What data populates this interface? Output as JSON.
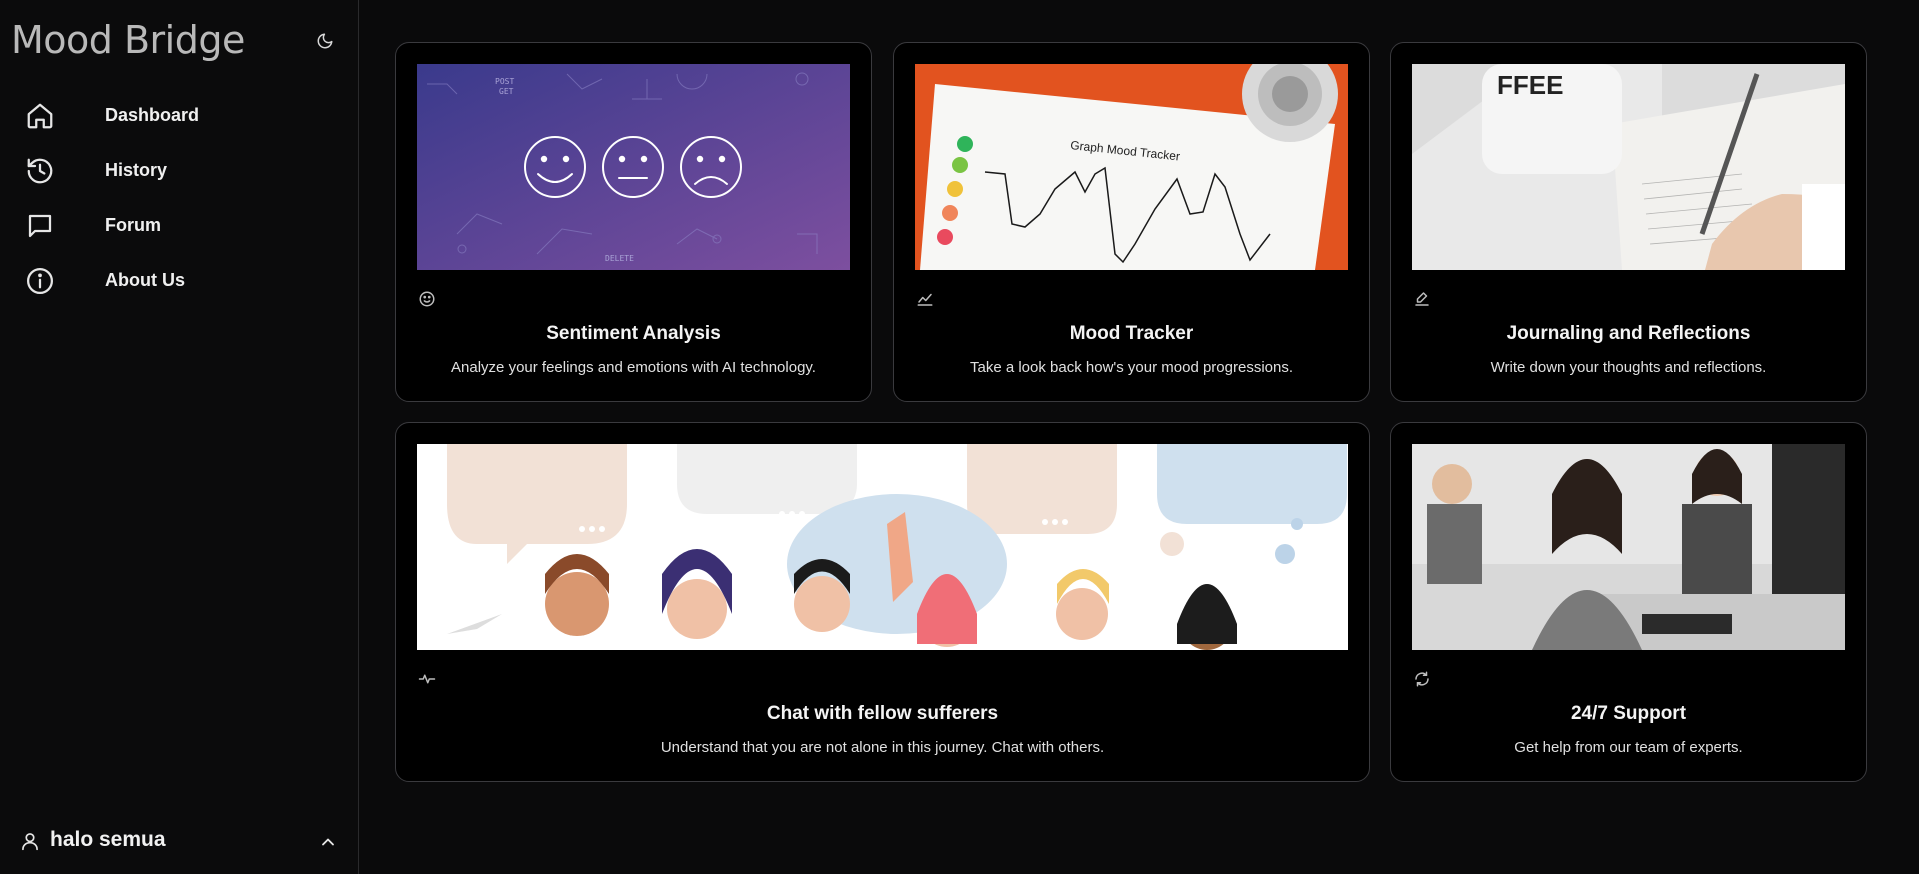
{
  "app": {
    "title": "Mood Bridge"
  },
  "sidebar": {
    "items": [
      {
        "label": "Dashboard",
        "icon": "home-icon"
      },
      {
        "label": "History",
        "icon": "history-icon"
      },
      {
        "label": "Forum",
        "icon": "chat-bubble-icon"
      },
      {
        "label": "About Us",
        "icon": "info-icon"
      }
    ]
  },
  "user": {
    "name": "halo semua"
  },
  "cards": [
    {
      "title": "Sentiment Analysis",
      "description": "Analyze your feelings and emotions with AI technology.",
      "icon": "face-smile-icon"
    },
    {
      "title": "Mood Tracker",
      "description": "Take a look back how's your mood progressions.",
      "icon": "line-chart-icon",
      "image_text": "Graph Mood Tracker"
    },
    {
      "title": "Journaling and Reflections",
      "description": "Write down your thoughts and reflections.",
      "icon": "pen-icon",
      "image_text": "FFEE"
    },
    {
      "title": "Chat with fellow sufferers",
      "description": "Understand that you are not alone in this journey. Chat with others.",
      "icon": "pulse-icon"
    },
    {
      "title": "24/7 Support",
      "description": "Get help from our team of experts.",
      "icon": "refresh-icon"
    }
  ],
  "colors": {
    "background": "#0a0a0b",
    "card_background": "#000000",
    "card_border": "#3a3a3e",
    "sentiment_gradient_start": "#3d3a8e",
    "sentiment_gradient_end": "#7e4f9e",
    "mood_tracker_bg": "#e2531f"
  }
}
